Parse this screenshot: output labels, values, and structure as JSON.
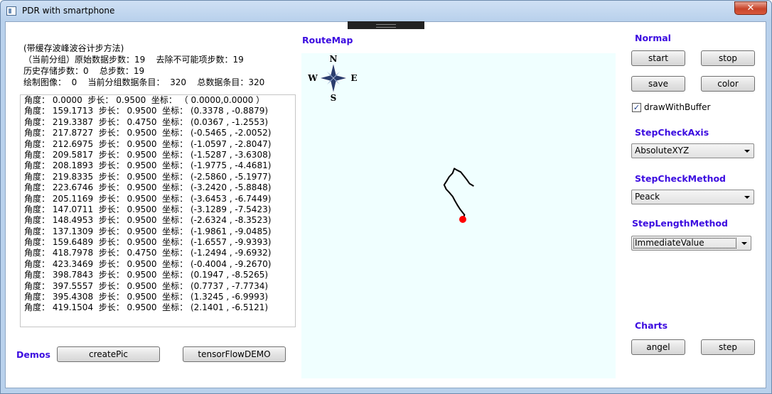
{
  "window": {
    "title": "PDR  with smartphone",
    "close_glyph": "✕"
  },
  "info": {
    "line1": "(带缓存波峰波谷计步方法)",
    "line2": "（当前分组）原始数据步数：19    去除不可能项步数：19",
    "line3": "历史存储步数：0    总步数：19",
    "line4": "绘制图像：  0    当前分组数据条目：  320    总数据条目：320"
  },
  "log_rows": [
    "角度： 0.0000  步长： 0.9500  坐标： （ 0.0000,0.0000 ）",
    "角度： 159.1713  步长： 0.9500  坐标： (0.3378 , -0.8879)",
    "角度： 219.3387  步长： 0.4750  坐标： (0.0367 , -1.2553)",
    "角度： 217.8727  步长： 0.9500  坐标： (-0.5465 , -2.0052)",
    "角度： 212.6975  步长： 0.9500  坐标： (-1.0597 , -2.8047)",
    "角度： 209.5817  步长： 0.9500  坐标： (-1.5287 , -3.6308)",
    "角度： 208.1893  步长： 0.9500  坐标： (-1.9775 , -4.4681)",
    "角度： 219.8335  步长： 0.9500  坐标： (-2.5860 , -5.1977)",
    "角度： 223.6746  步长： 0.9500  坐标： (-3.2420 , -5.8848)",
    "角度： 205.1169  步长： 0.9500  坐标： (-3.6453 , -6.7449)",
    "角度： 147.0711  步长： 0.9500  坐标： (-3.1289 , -7.5423)",
    "角度： 148.4953  步长： 0.9500  坐标： (-2.6324 , -8.3523)",
    "角度： 137.1309  步长： 0.9500  坐标： (-1.9861 , -9.0485)",
    "角度： 159.6489  步长： 0.9500  坐标： (-1.6557 , -9.9393)",
    "角度： 418.7978  步长： 0.4750  坐标： (-1.2494 , -9.6932)",
    "角度： 423.3469  步长： 0.9500  坐标： (-0.4004 , -9.2670)",
    "角度： 398.7843  步长： 0.9500  坐标： (0.1947 , -8.5265)",
    "角度： 397.5557  步长： 0.9500  坐标： (0.7737 , -7.7734)",
    "角度： 395.4308  步长： 0.9500  坐标： (1.3245 , -6.9993)",
    "角度： 419.1504  步长： 0.9500  坐标： (2.1401 , -6.5121)"
  ],
  "demos": {
    "label": "Demos",
    "create_pic": "createPic",
    "tensorflow": "tensorFlowDEMO"
  },
  "route_map": {
    "label": "RouteMap",
    "compass": {
      "n": "N",
      "s": "S",
      "w": "W",
      "e": "E"
    },
    "path_points": [
      [
        0.0,
        0.0
      ],
      [
        0.3378,
        -0.8879
      ],
      [
        0.0367,
        -1.2553
      ],
      [
        -0.5465,
        -2.0052
      ],
      [
        -1.0597,
        -2.8047
      ],
      [
        -1.5287,
        -3.6308
      ],
      [
        -1.9775,
        -4.4681
      ],
      [
        -2.586,
        -5.1977
      ],
      [
        -3.242,
        -5.8848
      ],
      [
        -3.6453,
        -6.7449
      ],
      [
        -3.1289,
        -7.5423
      ],
      [
        -2.6324,
        -8.3523
      ],
      [
        -1.9861,
        -9.0485
      ],
      [
        -1.6557,
        -9.9393
      ],
      [
        -1.2494,
        -9.6932
      ],
      [
        -0.4004,
        -9.267
      ],
      [
        0.1947,
        -8.5265
      ],
      [
        0.7737,
        -7.7734
      ],
      [
        1.3245,
        -6.9993
      ],
      [
        2.1401,
        -6.5121
      ]
    ],
    "start_marker_color": "#ff0000",
    "canvas_color": "#f0ffff"
  },
  "normal": {
    "label": "Normal",
    "start": "start",
    "stop": "stop",
    "save": "save",
    "color": "color",
    "draw_with_buffer": "drawWithBuffer",
    "draw_with_buffer_checked": true,
    "check_glyph": "✓"
  },
  "step_check_axis": {
    "label": "StepCheckAxis",
    "value": "AbsoluteXYZ"
  },
  "step_check_method": {
    "label": "StepCheckMethod",
    "value": "Peack"
  },
  "step_length_method": {
    "label": "StepLengthMethod",
    "value": "ImmediateValue"
  },
  "charts": {
    "label": "Charts",
    "angel": "angel",
    "step": "step"
  },
  "colors": {
    "section_label": "#3b0be0",
    "close_button": "#c8442a"
  }
}
